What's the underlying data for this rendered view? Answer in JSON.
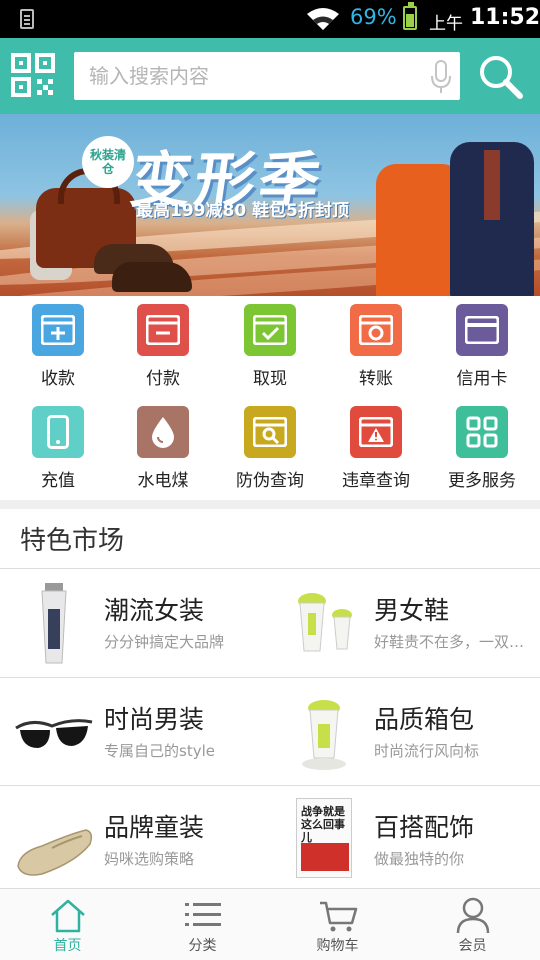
{
  "status_bar": {
    "battery_percent": "69%",
    "ampm": "上午",
    "time": "11:52",
    "battery_color": "#9bd14a",
    "percent_color": "#33b5e5"
  },
  "header": {
    "background_color": "#3fbdaa",
    "search_placeholder": "输入搜索内容",
    "qr_icon": "qr-code-icon",
    "mic_icon": "microphone-icon",
    "search_icon": "search-icon"
  },
  "banner": {
    "badge": "秋装清仓",
    "title": "变形季",
    "subtitle": "最高199减80  鞋包5折封顶"
  },
  "grid": {
    "items": [
      {
        "label": "收款",
        "icon": "receive-money-icon",
        "color": "#4aa6e0"
      },
      {
        "label": "付款",
        "icon": "pay-icon",
        "color": "#e0504a"
      },
      {
        "label": "取现",
        "icon": "withdraw-icon",
        "color": "#7cc633"
      },
      {
        "label": "转账",
        "icon": "transfer-icon",
        "color": "#f26b47"
      },
      {
        "label": "信用卡",
        "icon": "credit-card-icon",
        "color": "#6b5b9a"
      },
      {
        "label": "充值",
        "icon": "phone-recharge-icon",
        "color": "#5fcfc8"
      },
      {
        "label": "水电煤",
        "icon": "utilities-icon",
        "color": "#a87466"
      },
      {
        "label": "防伪查询",
        "icon": "anti-counterfeit-search-icon",
        "color": "#c8a81e"
      },
      {
        "label": "违章查询",
        "icon": "traffic-violation-icon",
        "color": "#e04b3e"
      },
      {
        "label": "更多服务",
        "icon": "more-services-icon",
        "color": "#3fbf99"
      }
    ]
  },
  "featured": {
    "title": "特色市场",
    "items": [
      {
        "name": "潮流女装",
        "desc": "分分钟搞定大品牌",
        "image": "cosmetic-tube-image"
      },
      {
        "name": "男女鞋",
        "desc": "好鞋贵不在多，一双…",
        "image": "garment-steamer-image"
      },
      {
        "name": "时尚男装",
        "desc": "专属自己的style",
        "image": "sunglasses-image"
      },
      {
        "name": "品质箱包",
        "desc": "时尚流行风向标",
        "image": "handheld-steamer-image"
      },
      {
        "name": "品牌童装",
        "desc": "妈咪选购策略",
        "image": "loafer-shoe-image"
      },
      {
        "name": "百搭配饰",
        "desc": "做最独特的你",
        "image": "book-image",
        "image_text": "战争就是这么回事儿"
      }
    ]
  },
  "bottom_nav": {
    "active_color": "#2fb3a0",
    "items": [
      {
        "label": "首页",
        "icon": "home-icon"
      },
      {
        "label": "分类",
        "icon": "list-icon"
      },
      {
        "label": "购物车",
        "icon": "cart-icon"
      },
      {
        "label": "会员",
        "icon": "user-icon"
      }
    ]
  }
}
